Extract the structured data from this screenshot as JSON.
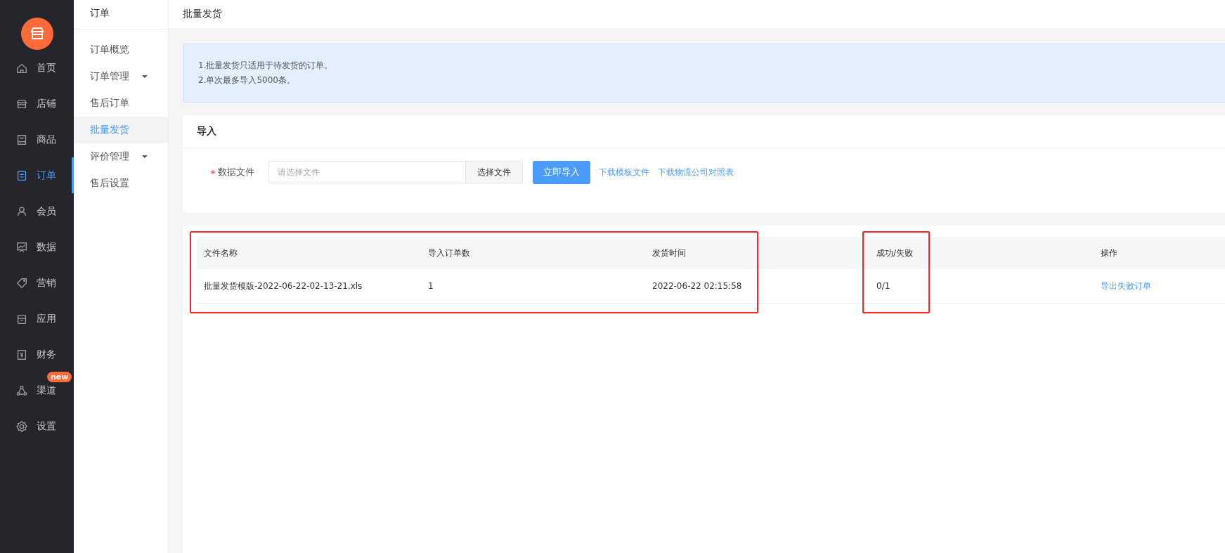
{
  "main_nav": [
    {
      "label": "首页",
      "selected": false
    },
    {
      "label": "店铺",
      "selected": false
    },
    {
      "label": "商品",
      "selected": false
    },
    {
      "label": "订单",
      "selected": true
    },
    {
      "label": "会员",
      "selected": false
    },
    {
      "label": "数据",
      "selected": false
    },
    {
      "label": "营销",
      "selected": false
    },
    {
      "label": "应用",
      "selected": false
    },
    {
      "label": "财务",
      "selected": false
    },
    {
      "label": "渠道",
      "selected": false,
      "badge": "new"
    },
    {
      "label": "设置",
      "selected": false
    }
  ],
  "sub_nav": {
    "title": "订单",
    "items": [
      {
        "label": "订单概览",
        "selected": false,
        "expandable": false
      },
      {
        "label": "订单管理",
        "selected": false,
        "expandable": true
      },
      {
        "label": "售后订单",
        "selected": false,
        "expandable": false
      },
      {
        "label": "批量发货",
        "selected": true,
        "expandable": false
      },
      {
        "label": "评价管理",
        "selected": false,
        "expandable": true
      },
      {
        "label": "售后设置",
        "selected": false,
        "expandable": false
      }
    ]
  },
  "page_title": "批量发货",
  "notice": [
    "1.批量发货只适用于待发货的订单。",
    "2.单次最多导入5000条。"
  ],
  "import_card": {
    "title": "导入",
    "field_label": "数据文件",
    "required": true,
    "file_placeholder": "请选择文件",
    "choose_button": "选择文件",
    "import_button": "立即导入",
    "links": [
      "下载模板文件",
      "下载物流公司对照表"
    ]
  },
  "table": {
    "columns": [
      {
        "title": "文件名称",
        "kind": "frame_start"
      },
      {
        "title": "导入订单数",
        "kind": "framed"
      },
      {
        "title": "发货时间",
        "kind": "framed"
      },
      {
        "title": "成功/失败",
        "kind": "frame_start"
      },
      {
        "title": "操作",
        "kind": "plain"
      }
    ],
    "rows": [
      {
        "cells": [
          {
            "text": "批量发货模版-2022-06-22-02-13-21.xls",
            "kind": "text"
          },
          {
            "text": "1",
            "kind": "text"
          },
          {
            "text": "2022-06-22 02:15:58",
            "kind": "text"
          },
          {
            "text": "0/1",
            "kind": "text"
          },
          {
            "text": "导出失败订单",
            "kind": "link"
          }
        ]
      }
    ]
  }
}
